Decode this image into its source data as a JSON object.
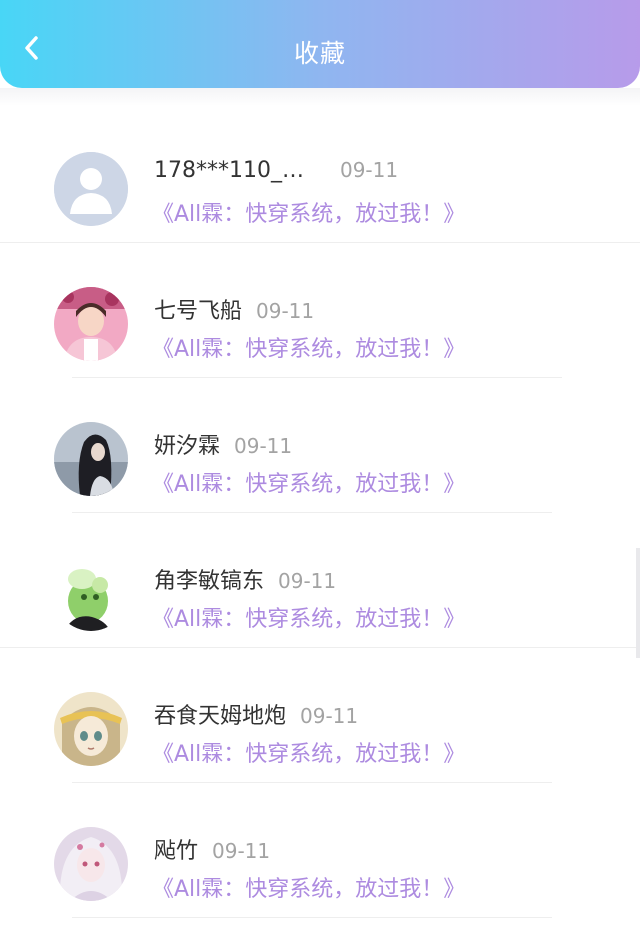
{
  "header": {
    "title": "收藏",
    "back_icon": "chevron-left-icon"
  },
  "items": [
    {
      "name": "178***110_…",
      "date": "09-11",
      "book": "《All霖：快穿系统，放过我！》",
      "avatar": "default-user-avatar"
    },
    {
      "name": "七号飞船",
      "date": "09-11",
      "book": "《All霖：快穿系统，放过我！》",
      "avatar": "pink-photo-avatar"
    },
    {
      "name": "妍汐霖",
      "date": "09-11",
      "book": "《All霖：快穿系统，放过我！》",
      "avatar": "girl-dark-hair-avatar"
    },
    {
      "name": "角李敏镐东",
      "date": "09-11",
      "book": "《All霖：快穿系统，放过我！》",
      "avatar": "green-character-avatar"
    },
    {
      "name": "吞食天姆地炮",
      "date": "09-11",
      "book": "《All霖：快穿系统，放过我！》",
      "avatar": "anime-girl-avatar"
    },
    {
      "name": "飐竹",
      "date": "09-11",
      "book": "《All霖：快穿系统，放过我！》",
      "avatar": "white-hair-girl-avatar"
    }
  ],
  "colors": {
    "header_gradient": [
      "#48d6f6",
      "#b79bea"
    ],
    "book_title": "#ad8be0",
    "date": "#a3a3a3"
  }
}
